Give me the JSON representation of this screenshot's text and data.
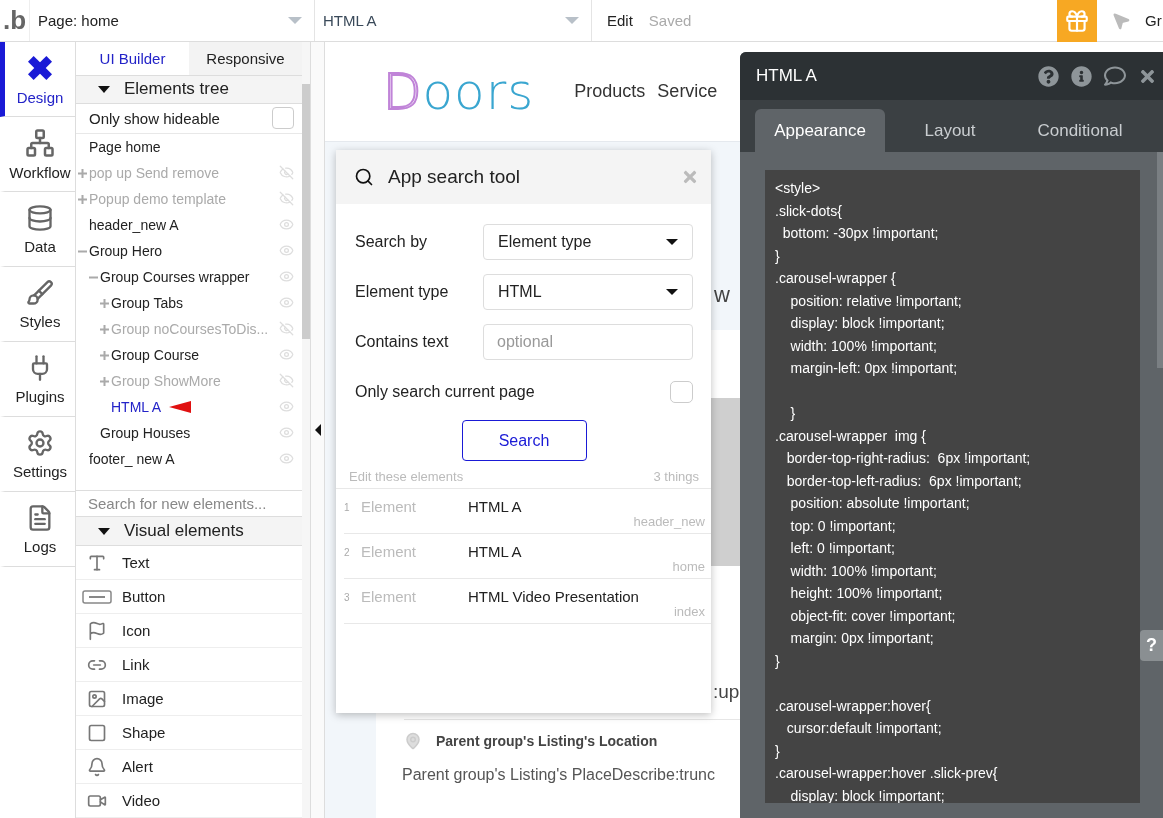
{
  "topbar": {
    "logo": ".b",
    "page_selector": "Page: home",
    "element_selector": "HTML A",
    "edit_label": "Edit",
    "status": "Saved",
    "user_cut": "Gr"
  },
  "nav": [
    {
      "label": "Design",
      "kind": "design",
      "selected": true
    },
    {
      "label": "Workflow",
      "kind": "workflow",
      "selected": false
    },
    {
      "label": "Data",
      "kind": "data",
      "selected": false
    },
    {
      "label": "Styles",
      "kind": "styles",
      "selected": false
    },
    {
      "label": "Plugins",
      "kind": "plugins",
      "selected": false
    },
    {
      "label": "Settings",
      "kind": "settings",
      "selected": false
    },
    {
      "label": "Logs",
      "kind": "logs",
      "selected": false
    }
  ],
  "panel_tabs": [
    {
      "label": "UI Builder",
      "selected": true
    },
    {
      "label": "Responsive",
      "selected": false
    }
  ],
  "elements_tree": {
    "title": "Elements tree",
    "expanded": true,
    "only_show_hideable": {
      "label": "Only show hideable",
      "checked": false
    },
    "items": [
      {
        "label": "Page home",
        "selected": false
      },
      {
        "label": "pop up Send remove",
        "expanded": false,
        "hidden": true,
        "selected": false
      },
      {
        "label": "Popup demo template",
        "expanded": false,
        "hidden": true,
        "selected": false
      },
      {
        "label": "header_new A",
        "hidden": false,
        "selected": false
      },
      {
        "label": "Group Hero",
        "expanded": true,
        "hidden": false,
        "selected": false,
        "children": [
          {
            "label": "Group Courses wrapper",
            "expanded": true,
            "hidden": false,
            "selected": false,
            "children": [
              {
                "label": "Group Tabs",
                "expanded": false,
                "hidden": false,
                "selected": false
              },
              {
                "label": "Group noCoursesToDis...",
                "expanded": false,
                "hidden": true,
                "selected": false
              },
              {
                "label": "Group Course",
                "expanded": false,
                "hidden": false,
                "selected": false
              },
              {
                "label": "Group ShowMore",
                "expanded": false,
                "hidden": true,
                "selected": false
              },
              {
                "label": "HTML A",
                "hidden": false,
                "selected": true
              }
            ]
          },
          {
            "label": "Group Houses",
            "hidden": false,
            "selected": false
          }
        ]
      },
      {
        "label": "footer_ new A",
        "hidden": false,
        "selected": false
      }
    ]
  },
  "search_field": {
    "placeholder": "Search for new elements..."
  },
  "visual_elements": {
    "title": "Visual elements",
    "expanded": true,
    "items": [
      {
        "label": "Text",
        "kind": "text"
      },
      {
        "label": "Button",
        "kind": "button"
      },
      {
        "label": "Icon",
        "kind": "icon"
      },
      {
        "label": "Link",
        "kind": "link"
      },
      {
        "label": "Image",
        "kind": "image"
      },
      {
        "label": "Shape",
        "kind": "shape"
      },
      {
        "label": "Alert",
        "kind": "alert"
      },
      {
        "label": "Video",
        "kind": "video"
      }
    ]
  },
  "canvas": {
    "logo": "Doors",
    "nav": [
      "Products",
      "Service"
    ],
    "fragment_top": "w",
    "fragment_bottom": ":up",
    "location": "Parent group's Listing's Location",
    "description": "Parent group's Listing's PlaceDescribe:trunc"
  },
  "search_tool": {
    "title": "App search tool",
    "fields": [
      {
        "label": "Search by",
        "kind": "select",
        "value": "Element type"
      },
      {
        "label": "Element type",
        "kind": "select",
        "value": "HTML"
      },
      {
        "label": "Contains text",
        "kind": "text",
        "placeholder": "optional"
      },
      {
        "label": "Only search current page",
        "kind": "checkbox",
        "checked": false
      }
    ],
    "button": "Search",
    "results_label": "Edit these elements",
    "results_count": "3 things",
    "results": [
      {
        "index": "1",
        "type": "Element",
        "name": "HTML A",
        "page": "header_new"
      },
      {
        "index": "2",
        "type": "Element",
        "name": "HTML A",
        "page": "home"
      },
      {
        "index": "3",
        "type": "Element",
        "name": "HTML Video Presentation",
        "page": "index"
      }
    ]
  },
  "property_editor": {
    "title": "HTML A",
    "tabs": [
      {
        "label": "Appearance",
        "selected": true
      },
      {
        "label": "Layout",
        "selected": false
      },
      {
        "label": "Conditional",
        "selected": false
      }
    ],
    "code": "<style>\n.slick-dots{\n  bottom: -30px !important;\n}\n.carousel-wrapper {\n    position: relative !important;\n    display: block !important;\n    width: 100% !important;\n    margin-left: 0px !important;\n\n    }\n.carousel-wrapper  img {\n   border-top-right-radius:  6px !important;\n   border-top-left-radius:  6px !important;\n    position: absolute !important;\n    top: 0 !important;\n    left: 0 !important;\n    width: 100% !important;\n    height: 100% !important;\n    object-fit: cover !important;\n    margin: 0px !important;\n}\n\n.carousel-wrapper:hover{\n   cursor:default !important;\n}\n.carousel-wrapper:hover .slick-prev{\n    display: block !important;",
    "help_tab": "?"
  }
}
